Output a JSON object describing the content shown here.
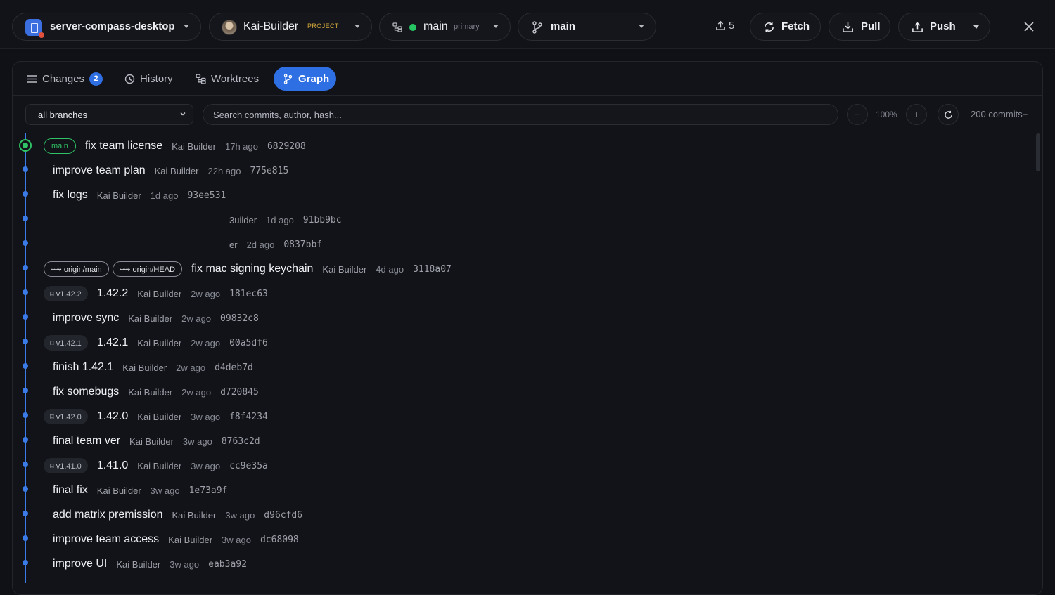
{
  "header": {
    "repo": "server-compass-desktop",
    "project": {
      "name": "Kai-Builder",
      "badge": "PROJECT"
    },
    "worktree": {
      "name": "main",
      "tag": "primary"
    },
    "branch": "main",
    "ahead_count": "5",
    "fetch_label": "Fetch",
    "pull_label": "Pull",
    "push_label": "Push"
  },
  "tabs": {
    "changes": {
      "label": "Changes",
      "count": "2"
    },
    "history": "History",
    "worktrees": "Worktrees",
    "graph": "Graph"
  },
  "filter": {
    "branch_select": "all branches",
    "search_placeholder": "Search commits, author, hash...",
    "zoom_out": "−",
    "zoom": "100%",
    "zoom_in": "+",
    "commit_count": "200 commits+"
  },
  "commits": [
    {
      "refs": [
        "main"
      ],
      "message": "fix team license",
      "author": "Kai Builder",
      "time": "17h ago",
      "hash": "6829208"
    },
    {
      "message": "improve team plan",
      "author": "Kai Builder",
      "time": "22h ago",
      "hash": "775e815"
    },
    {
      "message": "fix logs",
      "author": "Kai Builder",
      "time": "1d ago",
      "hash": "93ee531"
    },
    {
      "partial": "3uilder",
      "time": "1d ago",
      "hash": "91bb9bc"
    },
    {
      "partial": "er",
      "time": "2d ago",
      "hash": "0837bbf"
    },
    {
      "refs": [
        "⟿ origin/main",
        "⟿ origin/HEAD"
      ],
      "message": "fix mac signing keychain",
      "author": "Kai Builder",
      "time": "4d ago",
      "hash": "3118a07"
    },
    {
      "tag": "⌑ v1.42.2",
      "message": "1.42.2",
      "author": "Kai Builder",
      "time": "2w ago",
      "hash": "181ec63"
    },
    {
      "message": "improve sync",
      "author": "Kai Builder",
      "time": "2w ago",
      "hash": "09832c8"
    },
    {
      "tag": "⌑ v1.42.1",
      "message": "1.42.1",
      "author": "Kai Builder",
      "time": "2w ago",
      "hash": "00a5df6"
    },
    {
      "message": "finish 1.42.1",
      "author": "Kai Builder",
      "time": "2w ago",
      "hash": "d4deb7d"
    },
    {
      "message": "fix somebugs",
      "author": "Kai Builder",
      "time": "2w ago",
      "hash": "d720845"
    },
    {
      "tag": "⌑ v1.42.0",
      "message": "1.42.0",
      "author": "Kai Builder",
      "time": "3w ago",
      "hash": "f8f4234"
    },
    {
      "message": "final team ver",
      "author": "Kai Builder",
      "time": "3w ago",
      "hash": "8763c2d"
    },
    {
      "tag": "⌑ v1.41.0",
      "message": "1.41.0",
      "author": "Kai Builder",
      "time": "3w ago",
      "hash": "cc9e35a"
    },
    {
      "message": "final fix",
      "author": "Kai Builder",
      "time": "3w ago",
      "hash": "1e73a9f"
    },
    {
      "message": "add matrix premission",
      "author": "Kai Builder",
      "time": "3w ago",
      "hash": "d96cfd6"
    },
    {
      "message": "improve team access",
      "author": "Kai Builder",
      "time": "3w ago",
      "hash": "dc68098"
    },
    {
      "message": "improve UI",
      "author": "Kai Builder",
      "time": "3w ago",
      "hash": "eab3a92"
    }
  ],
  "colors": {
    "accent": "#2f6fe4",
    "graph_line": "#3a7be8",
    "head": "#2fc266",
    "project_badge": "#d4a93a"
  }
}
